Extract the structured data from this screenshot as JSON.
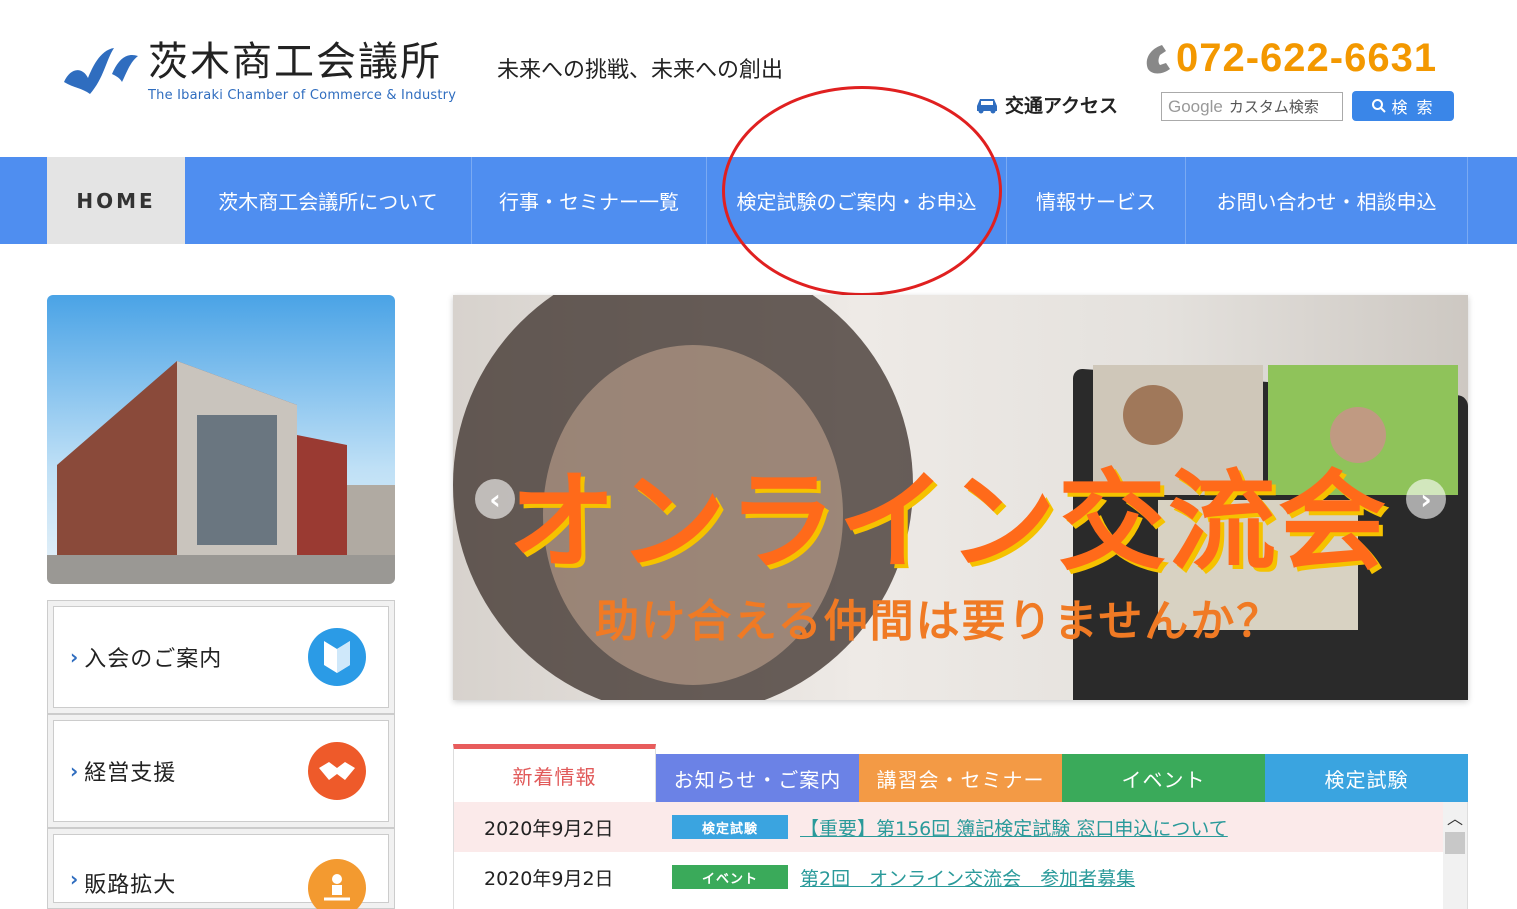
{
  "header": {
    "logo_title": "茨木商工会議所",
    "logo_en": "The Ibaraki Chamber of Commerce & Industry",
    "tagline": "未来への挑戦、未来への創出",
    "phone": "072-622-6631",
    "access_label": "交通アクセス",
    "search_brand": "Google",
    "search_placeholder": "カスタム検索",
    "search_button": "検 索"
  },
  "nav": {
    "items": [
      {
        "label": "HOME"
      },
      {
        "label": "茨木商工会議所について"
      },
      {
        "label": "行事・セミナー一覧"
      },
      {
        "label": "検定試験のご案内・お申込"
      },
      {
        "label": "情報サービス"
      },
      {
        "label": "お問い合わせ・相談申込"
      }
    ]
  },
  "sidebar": {
    "buttons": [
      {
        "label": "入会のご案内",
        "icon": "beginner-mark-icon"
      },
      {
        "label": "経営支援",
        "icon": "handshake-icon"
      },
      {
        "label": "販路拡大",
        "icon": "person-network-icon"
      }
    ]
  },
  "banner": {
    "title": "オンライン交流会",
    "subtitle": "助け合える仲間は要りませんか？"
  },
  "tabs": [
    {
      "label": "新着情報",
      "color": "#ffffff"
    },
    {
      "label": "お知らせ・ご案内",
      "color": "#6b82e6"
    },
    {
      "label": "講習会・セミナー",
      "color": "#f39a45"
    },
    {
      "label": "イベント",
      "color": "#3aaa5a"
    },
    {
      "label": "検定試験",
      "color": "#3aa4e0"
    }
  ],
  "news": [
    {
      "date": "2020年9月2日",
      "badge": "検定試験",
      "badge_color": "#3aa4e0",
      "title": "【重要】第156回 簿記検定試験 窓口申込について"
    },
    {
      "date": "2020年9月2日",
      "badge": "イベント",
      "badge_color": "#3aaa5a",
      "title": "第2回　オンライン交流会　参加者募集"
    }
  ]
}
